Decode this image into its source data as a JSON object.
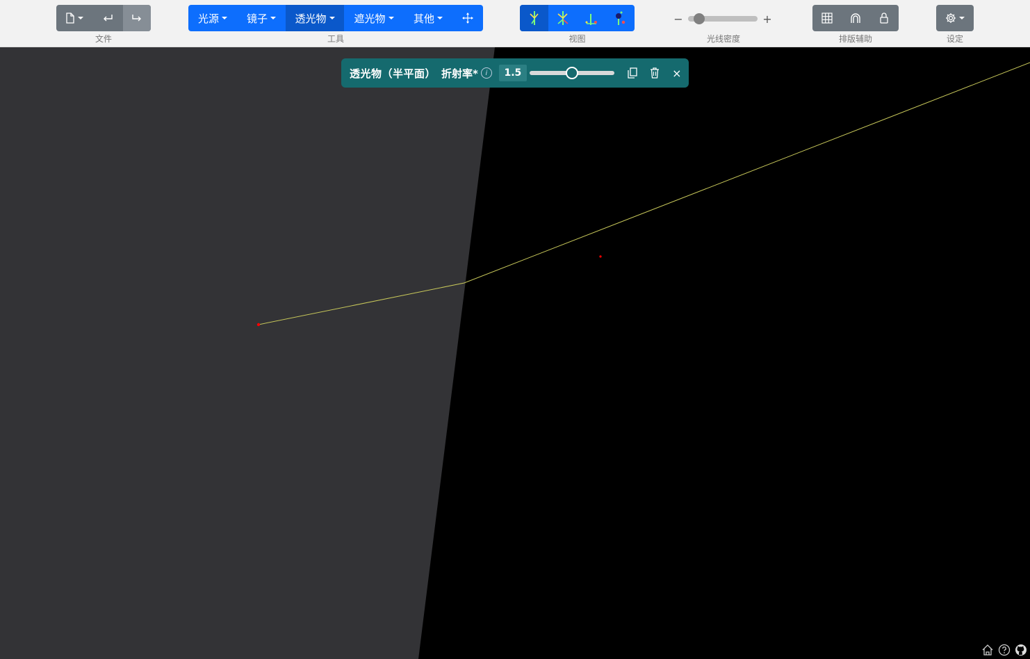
{
  "toolbar": {
    "file_label": "文件",
    "tools_label": "工具",
    "view_label": "视图",
    "density_label": "光线密度",
    "density_minus": "−",
    "density_plus": "+",
    "layout_label": "排版辅助",
    "settings_label": "设定",
    "tools": [
      {
        "label": "光源"
      },
      {
        "label": "镜子"
      },
      {
        "label": "透光物"
      },
      {
        "label": "遮光物"
      },
      {
        "label": "其他"
      }
    ],
    "active_tool": "透光物"
  },
  "object_bar": {
    "title": "透光物（半平面）",
    "property_label": "折射率*",
    "info_icon": "i",
    "value": "1.5",
    "slider_fraction": 0.5,
    "close_label": "×"
  },
  "colors": {
    "canvas": "#000000",
    "glass": "#333336",
    "ray": "#c8c85a",
    "point": "#ff0000",
    "toolbar": "#f2f2f2",
    "primary": "#0d6efd",
    "secondary": "#6c757d",
    "object_bar": "#156a6e"
  },
  "icons": [
    "new-file-icon",
    "undo-icon",
    "redo-icon",
    "move-icon",
    "view-rays-icon",
    "view-extended-icon",
    "view-images-icon",
    "view-observer-icon",
    "grid-icon",
    "snap-icon",
    "lock-icon",
    "gear-icon",
    "duplicate-icon",
    "trash-icon",
    "home-icon",
    "help-icon",
    "github-icon"
  ]
}
